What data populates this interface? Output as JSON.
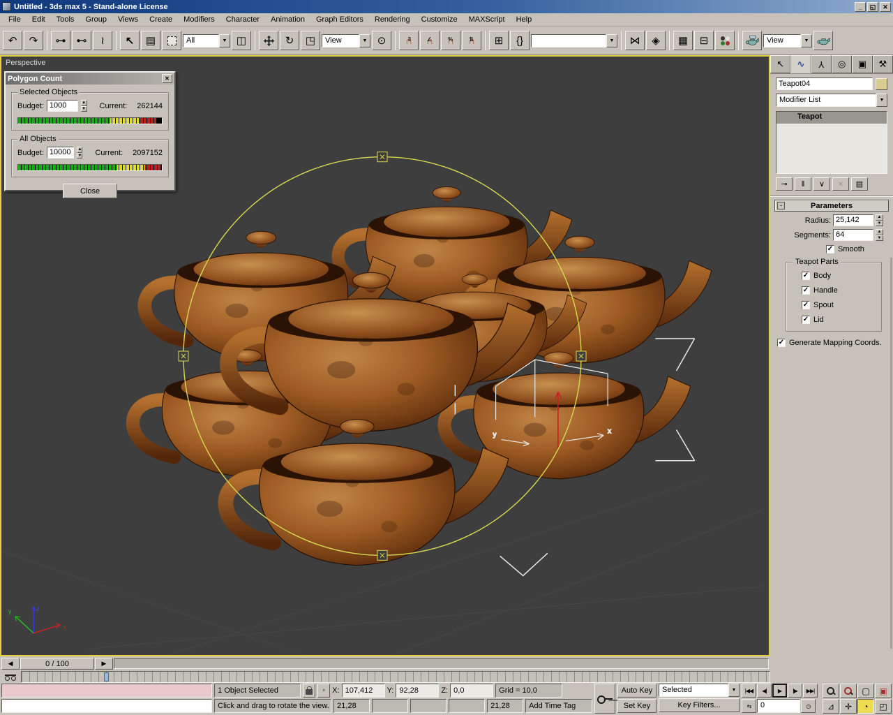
{
  "window": {
    "title": "Untitled - 3ds max 5 - Stand-alone License"
  },
  "menu": {
    "items": [
      "File",
      "Edit",
      "Tools",
      "Group",
      "Views",
      "Create",
      "Modifiers",
      "Character",
      "Animation",
      "Graph Editors",
      "Rendering",
      "Customize",
      "MAXScript",
      "Help"
    ]
  },
  "toolbar": {
    "selection_filter": "All",
    "coord_system": "View",
    "named_sets": "",
    "render_type": "View"
  },
  "viewport": {
    "label": "Perspective",
    "axis": {
      "x": "x",
      "y": "y",
      "z": "z"
    }
  },
  "polygon_count": {
    "title": "Polygon Count",
    "selected_group": "Selected Objects",
    "all_group": "All Objects",
    "budget_label": "Budget:",
    "current_label": "Current:",
    "selected_budget": "1000",
    "selected_current": "262144",
    "all_budget": "10000",
    "all_current": "2097152",
    "close_label": "Close"
  },
  "command_panel": {
    "object_name": "Teapot04",
    "modifier_list": "Modifier List",
    "stack": [
      "Teapot"
    ],
    "parameters": {
      "title": "Parameters",
      "radius_label": "Radius:",
      "radius": "25,142",
      "segments_label": "Segments:",
      "segments": "64",
      "smooth": "Smooth",
      "teapot_parts": "Teapot Parts",
      "parts": [
        "Body",
        "Handle",
        "Spout",
        "Lid"
      ],
      "gen_mapping": "Generate Mapping Coords."
    }
  },
  "timeline": {
    "slider": "0 / 100"
  },
  "status": {
    "selection": "1 Object Selected",
    "prompt": "Click and drag to rotate the view.",
    "x_label": "X:",
    "x": "107,412",
    "y_label": "Y:",
    "y": "92,28",
    "z_label": "Z:",
    "z": "0,0",
    "grid": "Grid = 10,0",
    "time_tag": "Add Time Tag",
    "cell_left": "21,28",
    "cell_right": "21,28",
    "auto_key": "Auto Key",
    "set_key": "Set Key",
    "key_dropdown": "Selected",
    "key_filters": "Key Filters...",
    "frame": "0"
  },
  "colors": {
    "viewport_border": "#e3cf45",
    "object_color": "#d9cc8f",
    "progress_green": "#1ea51e",
    "progress_yellow": "#e0dc3c",
    "progress_red": "#b82020",
    "active_nav_button": "#f0dc50",
    "titlebar_blue": "#10387e"
  }
}
